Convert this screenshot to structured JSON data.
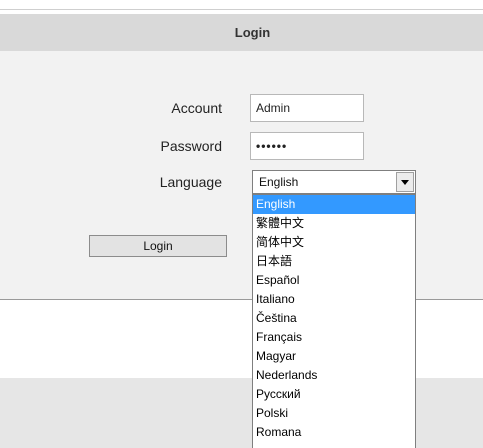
{
  "header": {
    "title": "Login"
  },
  "form": {
    "account_label": "Account",
    "account_value": "Admin",
    "password_label": "Password",
    "password_value": "••••••",
    "language_label": "Language",
    "language_value": "English",
    "login_button": "Login"
  },
  "language_dropdown": {
    "selected": "English",
    "options": [
      "English",
      "繁體中文",
      "简体中文",
      "日本語",
      "Español",
      "Italiano",
      "Čeština",
      "Français",
      "Magyar",
      "Nederlands",
      "Русский",
      "Polski",
      "Romana"
    ]
  },
  "colors": {
    "header_bg": "#d9d9d9",
    "panel_bg": "#f2f2f2",
    "selection": "#3399ff"
  }
}
